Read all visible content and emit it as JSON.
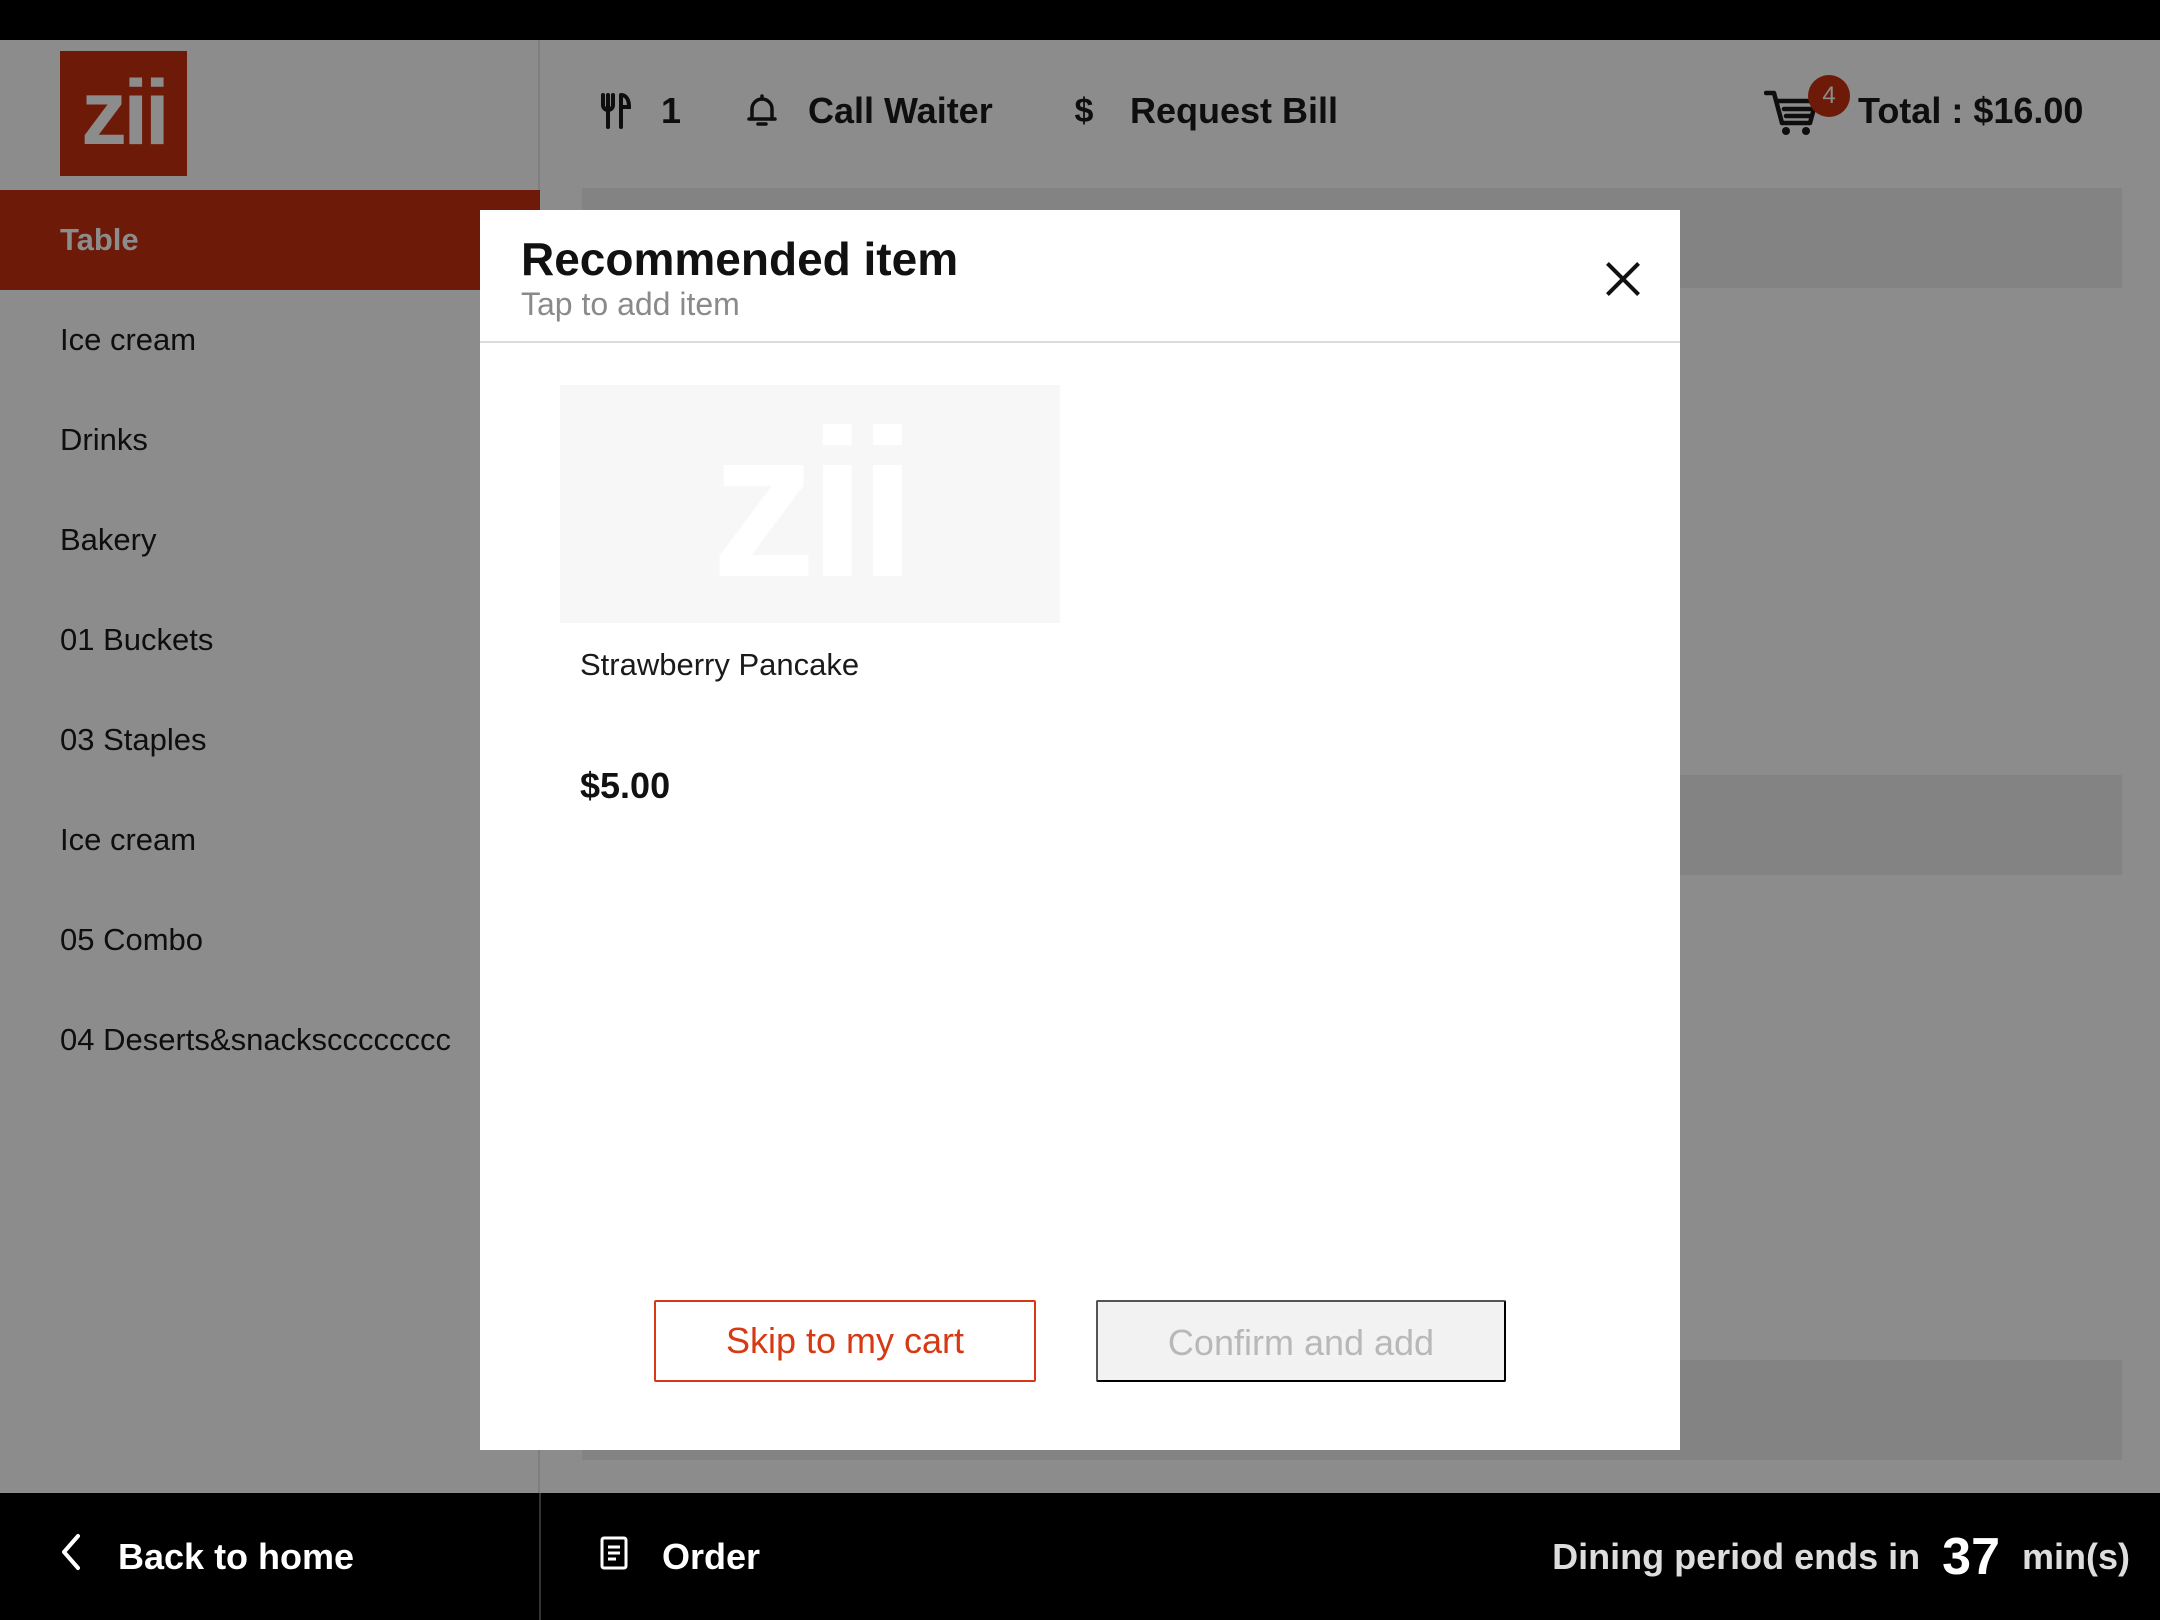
{
  "brand": {
    "logo_text": "zii",
    "accent_color": "#c8300f"
  },
  "sidebar": {
    "items": [
      {
        "label": "Table",
        "active": true
      },
      {
        "label": "Ice cream"
      },
      {
        "label": "Drinks"
      },
      {
        "label": "Bakery"
      },
      {
        "label": "01 Buckets"
      },
      {
        "label": "03 Staples"
      },
      {
        "label": "Ice cream"
      },
      {
        "label": "05 Combo"
      },
      {
        "label": "04 Deserts&snackscccccccc"
      }
    ]
  },
  "topbar": {
    "table_number": "1",
    "call_waiter": "Call Waiter",
    "request_bill": "Request Bill",
    "cart_count": "4",
    "total": "Total : $16.00"
  },
  "bottombar": {
    "back": "Back to home",
    "order": "Order",
    "dining_prefix": "Dining period ends in",
    "dining_minutes": "37",
    "dining_suffix": "min(s)"
  },
  "modal": {
    "title": "Recommended item",
    "subtitle": "Tap to add item",
    "item": {
      "name": "Strawberry Pancake",
      "price": "$5.00",
      "image_logo": "zii"
    },
    "skip_label": "Skip to my cart",
    "confirm_label": "Confirm and add"
  }
}
